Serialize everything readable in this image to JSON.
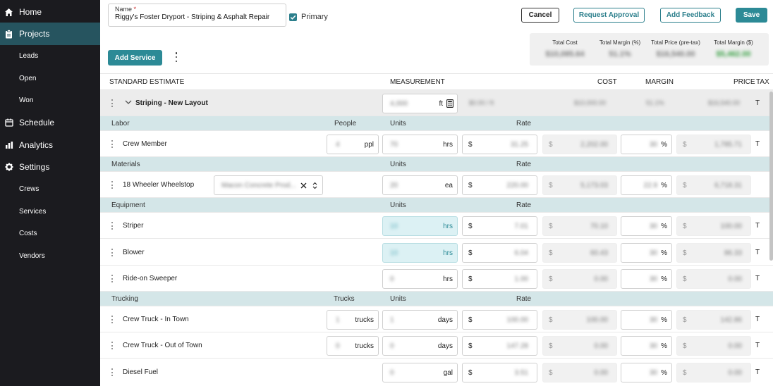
{
  "sidebar": {
    "items": [
      {
        "label": "Home",
        "icon": "home-icon"
      },
      {
        "label": "Projects",
        "icon": "clipboard-icon"
      },
      {
        "label": "Leads"
      },
      {
        "label": "Open"
      },
      {
        "label": "Won"
      },
      {
        "label": "Schedule",
        "icon": "calendar-icon"
      },
      {
        "label": "Analytics",
        "icon": "bar-chart-icon"
      },
      {
        "label": "Settings",
        "icon": "gear-icon"
      },
      {
        "label": "Crews"
      },
      {
        "label": "Services"
      },
      {
        "label": "Costs"
      },
      {
        "label": "Vendors"
      }
    ]
  },
  "header": {
    "name_label": "Name",
    "required_mark": "*",
    "name_value": "Riggy's Foster Dryport - Striping & Asphalt Repair",
    "primary_label": "Primary",
    "primary_checked": true,
    "cancel": "Cancel",
    "request_approval": "Request Approval",
    "add_feedback": "Add Feedback",
    "save": "Save",
    "add_service": "Add Service"
  },
  "totals": [
    {
      "label": "Total Cost",
      "value": "$10,085.64"
    },
    {
      "label": "Total Margin (%)",
      "value": "51.1%"
    },
    {
      "label": "Total Price (pre-tax)",
      "value": "$16,540.00"
    },
    {
      "label": "Total Margin ($)",
      "value": "$5,462.00"
    }
  ],
  "columns": {
    "estimate": "STANDARD ESTIMATE",
    "measurement": "MEASUREMENT",
    "cost": "COST",
    "margin": "MARGIN",
    "price": "PRICE",
    "tax": "TAX"
  },
  "service": {
    "name": "Striping - New Layout",
    "measurement": "4,000",
    "unit": "ft",
    "rate": "$0.00 / ft",
    "cost": "$10,000.00",
    "margin": "51.1%",
    "price": "$16,540.00",
    "tax": "T"
  },
  "sections": {
    "labor": {
      "label": "Labor",
      "people": "People",
      "units": "Units",
      "rate": "Rate"
    },
    "materials": {
      "label": "Materials",
      "units": "Units",
      "rate": "Rate"
    },
    "equipment": {
      "label": "Equipment",
      "units": "Units",
      "rate": "Rate"
    },
    "trucking": {
      "label": "Trucking",
      "trucks": "Trucks",
      "units": "Units",
      "rate": "Rate"
    }
  },
  "items": {
    "crew_member": {
      "name": "Crew Member",
      "people": "4",
      "people_unit": "ppl",
      "units": "70",
      "unit": "hrs",
      "currency": "$",
      "rate": "31.25",
      "cost": "2,202.00",
      "margin": "30",
      "pct": "%",
      "price": "1,785.71",
      "tax": "T"
    },
    "wheelstop": {
      "name": "18 Wheeler Wheelstop",
      "vendor": "Macon Concrete Prod...",
      "units": "20",
      "unit": "ea",
      "currency": "$",
      "rate": "220.00",
      "cost": "5,173.03",
      "margin": "22.9",
      "pct": "%",
      "price": "6,718.31"
    },
    "striper": {
      "name": "Striper",
      "units": "10",
      "unit": "hrs",
      "currency": "$",
      "rate": "7.01",
      "cost": "70.10",
      "margin": "30",
      "pct": "%",
      "price": "100.00",
      "tax": "T"
    },
    "blower": {
      "name": "Blower",
      "units": "10",
      "unit": "hrs",
      "currency": "$",
      "rate": "6.04",
      "cost": "60.43",
      "margin": "30",
      "pct": "%",
      "price": "86.33",
      "tax": "T"
    },
    "sweeper": {
      "name": "Ride-on Sweeper",
      "units": "0",
      "unit": "hrs",
      "currency": "$",
      "rate": "1.00",
      "cost": "0.00",
      "margin": "30",
      "pct": "%",
      "price": "0.00",
      "tax": "T"
    },
    "truck_in": {
      "name": "Crew Truck - In Town",
      "trucks": "1",
      "trucks_unit": "trucks",
      "units": "1",
      "unit": "days",
      "currency": "$",
      "rate": "100.00",
      "cost": "100.00",
      "margin": "30",
      "pct": "%",
      "price": "142.86",
      "tax": "T"
    },
    "truck_out": {
      "name": "Crew Truck - Out of Town",
      "trucks": "0",
      "trucks_unit": "trucks",
      "units": "0",
      "unit": "days",
      "currency": "$",
      "rate": "147.28",
      "cost": "0.00",
      "margin": "30",
      "pct": "%",
      "price": "0.00",
      "tax": "T"
    },
    "diesel": {
      "name": "Diesel Fuel",
      "units": "0",
      "unit": "gal",
      "currency": "$",
      "rate": "3.51",
      "cost": "0.00",
      "margin": "30",
      "pct": "%",
      "price": "0.00",
      "tax": "T"
    }
  }
}
